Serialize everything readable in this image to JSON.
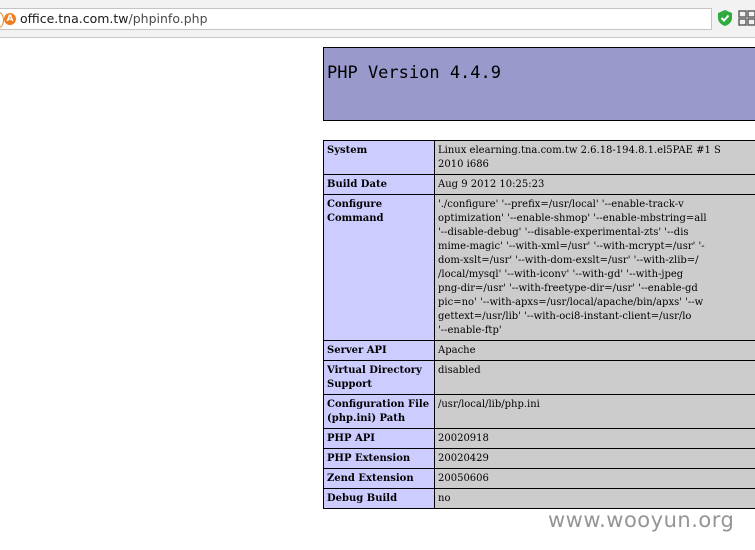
{
  "browser": {
    "url_host": "office.tna.com.tw",
    "url_path": "/phpinfo.php"
  },
  "header": {
    "title": "PHP Version 4.4.9"
  },
  "rows": [
    {
      "key": "System",
      "lines": [
        "Linux elearning.tna.com.tw 2.6.18-194.8.1.el5PAE #1 S",
        "2010 i686"
      ]
    },
    {
      "key": "Build Date",
      "lines": [
        "Aug 9 2012 10:25:23"
      ]
    },
    {
      "key": "Configure Command",
      "lines": [
        "'./configure' '--prefix=/usr/local' '--enable-track-v",
        "optimization' '--enable-shmop' '--enable-mbstring=all",
        "'--disable-debug' '--disable-experimental-zts' '--dis",
        "mime-magic' '--with-xml=/usr' '--with-mcrypt=/usr' '-",
        "dom-xslt=/usr' '--with-dom-exslt=/usr' '--with-zlib=/",
        "/local/mysql' '--with-iconv' '--with-gd' '--with-jpeg",
        "png-dir=/usr' '--with-freetype-dir=/usr' '--enable-gd",
        "pic=no' '--with-apxs=/usr/local/apache/bin/apxs' '--w",
        "gettext=/usr/lib' '--with-oci8-instant-client=/usr/lo",
        "'--enable-ftp'"
      ]
    },
    {
      "key": "Server API",
      "lines": [
        "Apache"
      ]
    },
    {
      "key": "Virtual Directory Support",
      "lines": [
        "disabled"
      ]
    },
    {
      "key": "Configuration File (php.ini) Path",
      "lines": [
        "/usr/local/lib/php.ini"
      ]
    },
    {
      "key": "PHP API",
      "lines": [
        "20020918"
      ]
    },
    {
      "key": "PHP Extension",
      "lines": [
        "20020429"
      ]
    },
    {
      "key": "Zend Extension",
      "lines": [
        "20050606"
      ]
    },
    {
      "key": "Debug Build",
      "lines": [
        "no"
      ]
    }
  ],
  "watermark": "www.wooyun.org",
  "icons": {
    "site": "site-favicon-icon",
    "shield": "shield-check-icon",
    "grid": "app-grid-icon"
  },
  "colors": {
    "header_bg": "#9999cc",
    "key_bg": "#ccccff",
    "value_bg": "#cccccc",
    "shield": "#2eaa3f"
  }
}
